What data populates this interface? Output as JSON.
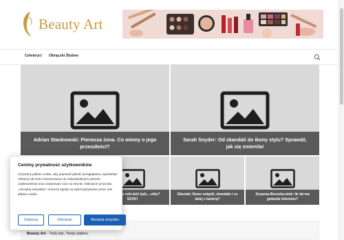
{
  "header": {
    "logo_text": "Beauty Art",
    "banner_icon": "makeup-banner-image"
  },
  "nav": {
    "items": [
      {
        "label": "Celebryci"
      },
      {
        "label": "Obrączki Ślubne"
      }
    ],
    "search_icon": "search-icon"
  },
  "posts": [
    {
      "title": "Adrian Stankowski: Pierwsza żona. Co wiemy o jego przeszłości?"
    },
    {
      "title": "Sarah Snyder: Od skandali do ikony stylu? Sprawdź, jak się zmienila!"
    },
    {
      "title": "...yszyn: Co robi dziś były ...olity? SZOK!"
    },
    {
      "title": "Zduniak: Nowe związki, skandale i co dalej z karierą?"
    },
    {
      "title": "Zuzanna Borucka wiek: Ile lat ma gwiazda internetu?"
    }
  ],
  "footer": {
    "brand": "Beauty Art",
    "tagline": " - Twój styl, Twoje piękno."
  },
  "cookie": {
    "title": "Cenimy prywatność użytkowników",
    "body": "Używamy plików cookie, aby poprawić jakość przeglądania, wyświetlać reklamy lub treści dostosowane do indywidualnych potrzeb użytkowników oraz analizować ruch na stronie. Kliknięcie przycisku „Akceptuj wszystkie” oznacza zgodę na wykorzystywanie przez nas plików cookie.",
    "customize_label": "Dostosuj",
    "reject_label": "Odrzucać",
    "accept_label": "Akceptuj wszystko"
  },
  "colors": {
    "logo": "#c79a3e",
    "accent": "#1a5fb4",
    "placeholder": "#d9d9d9",
    "caption_bg": "#282828"
  }
}
